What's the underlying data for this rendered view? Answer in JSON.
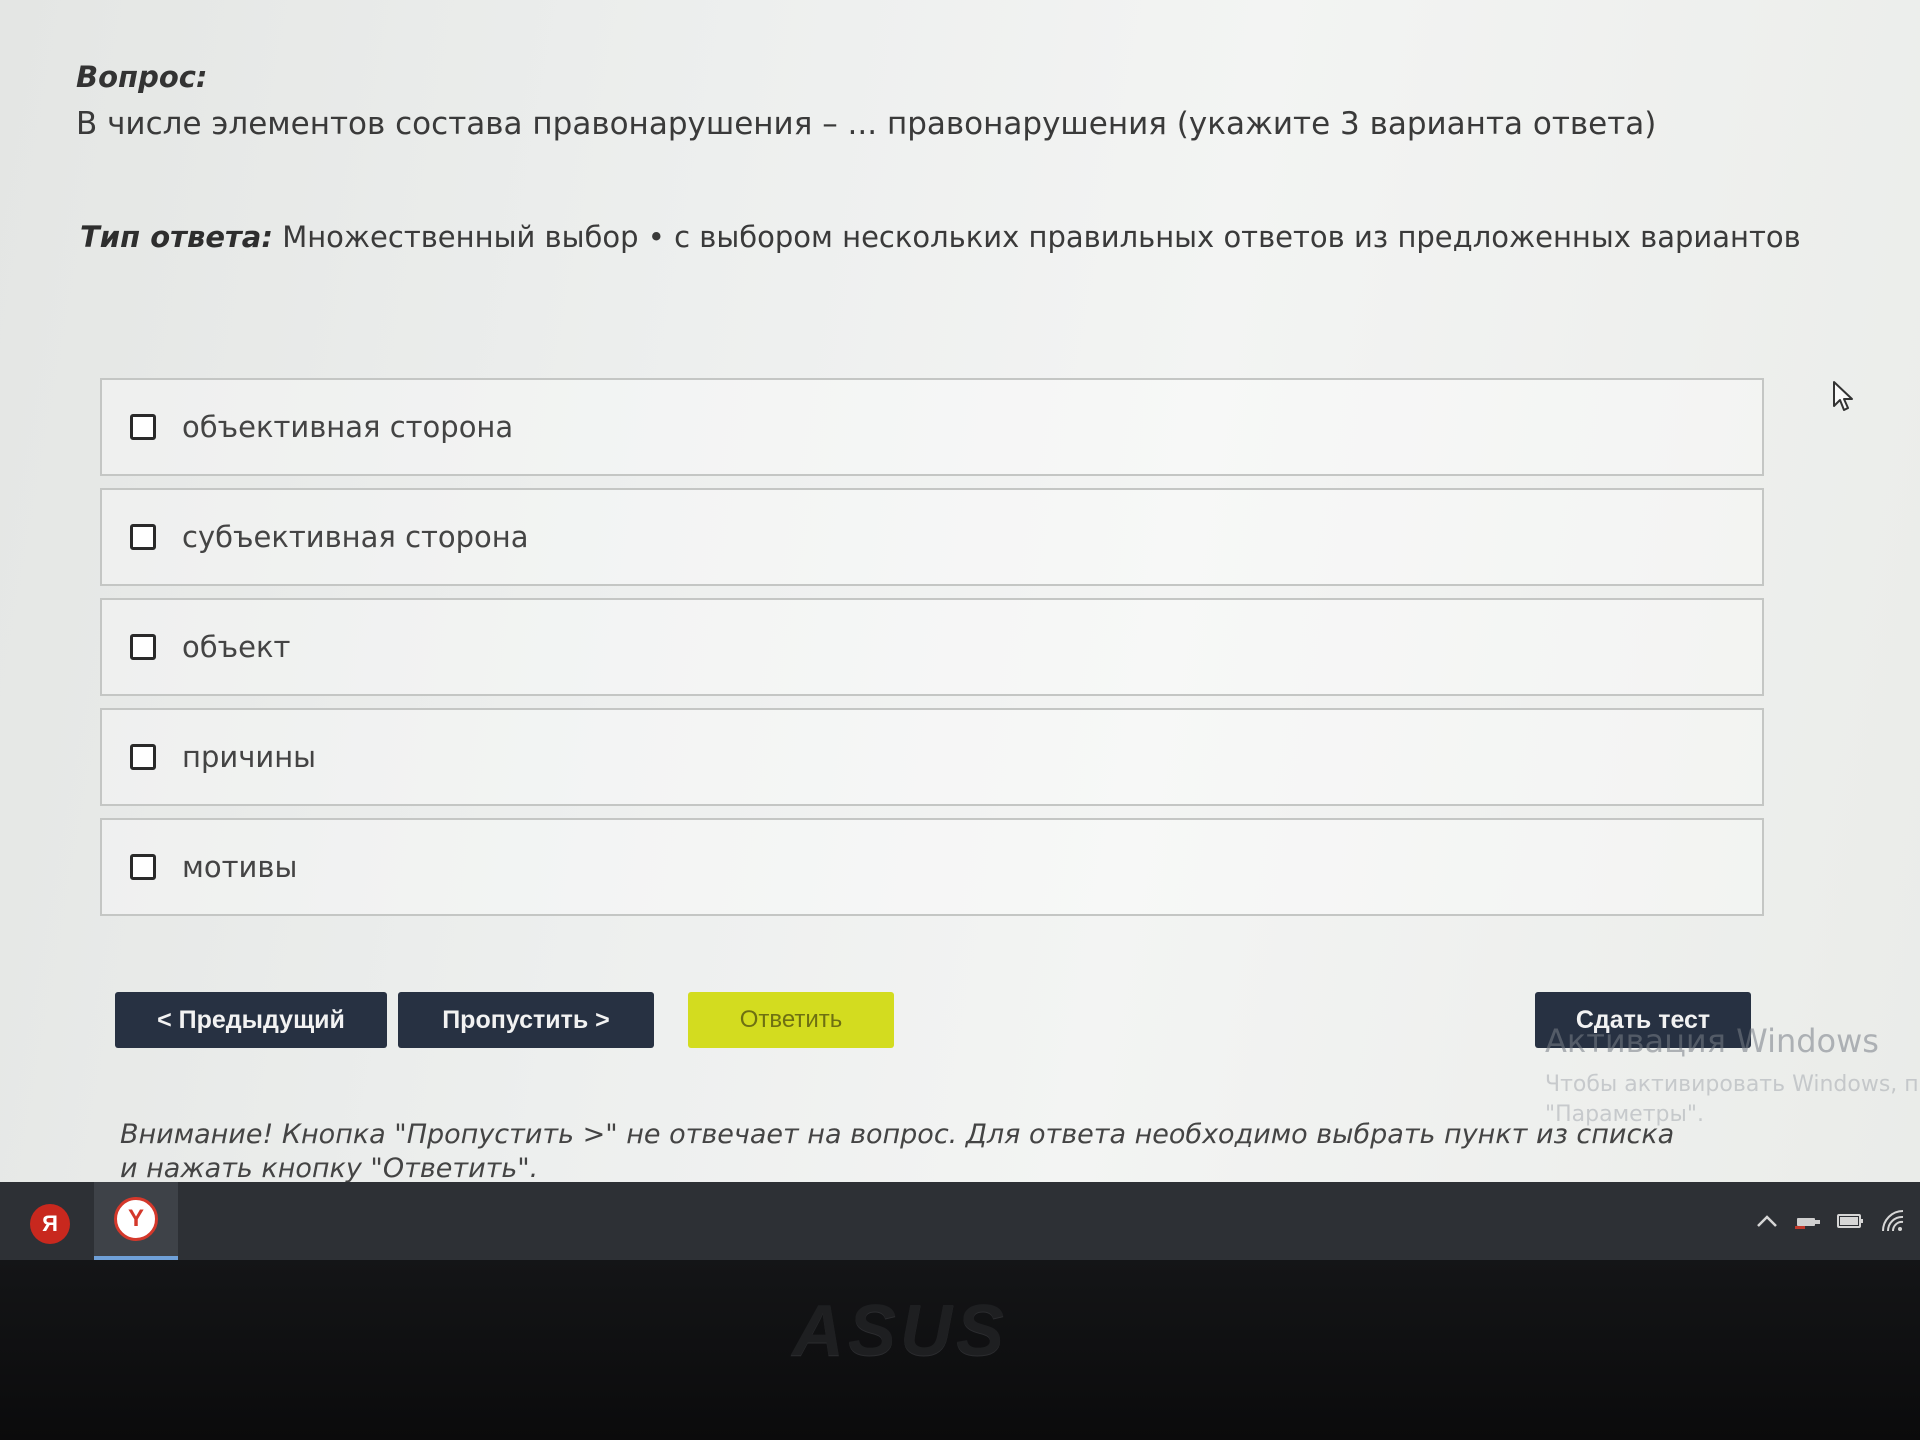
{
  "question": {
    "label": "Вопрос:",
    "text": "В числе элементов состава правонарушения – ... правонарушения (укажите 3 варианта ответа)"
  },
  "answer_type": {
    "label": "Тип ответа:",
    "value": "Множественный выбор • с выбором нескольких правильных ответов из предложенных вариантов"
  },
  "options": [
    {
      "label": "объективная сторона",
      "checked": false
    },
    {
      "label": "субъективная сторона",
      "checked": false
    },
    {
      "label": "объект",
      "checked": false
    },
    {
      "label": "причины",
      "checked": false
    },
    {
      "label": "мотивы",
      "checked": false
    }
  ],
  "buttons": {
    "prev": "< Предыдущий",
    "skip": "Пропустить >",
    "answer": "Ответить",
    "finish": "Сдать тест"
  },
  "warning": "Внимание! Кнопка \"Пропустить >\" не отвечает на вопрос. Для ответа необходимо выбрать пункт из списка и нажать кнопку \"Ответить\".",
  "watermark": {
    "title": "Активация Windows",
    "line1": "Чтобы активировать Windows, п",
    "line2": "\"Параметры\"."
  },
  "taskbar": {
    "yandex_letter": "Я",
    "browser_letter": "Y"
  },
  "bezel_brand": "ASUS",
  "colors": {
    "dark_button": "#273142",
    "answer_button": "#d3dc1f",
    "taskbar": "#2d3035"
  }
}
